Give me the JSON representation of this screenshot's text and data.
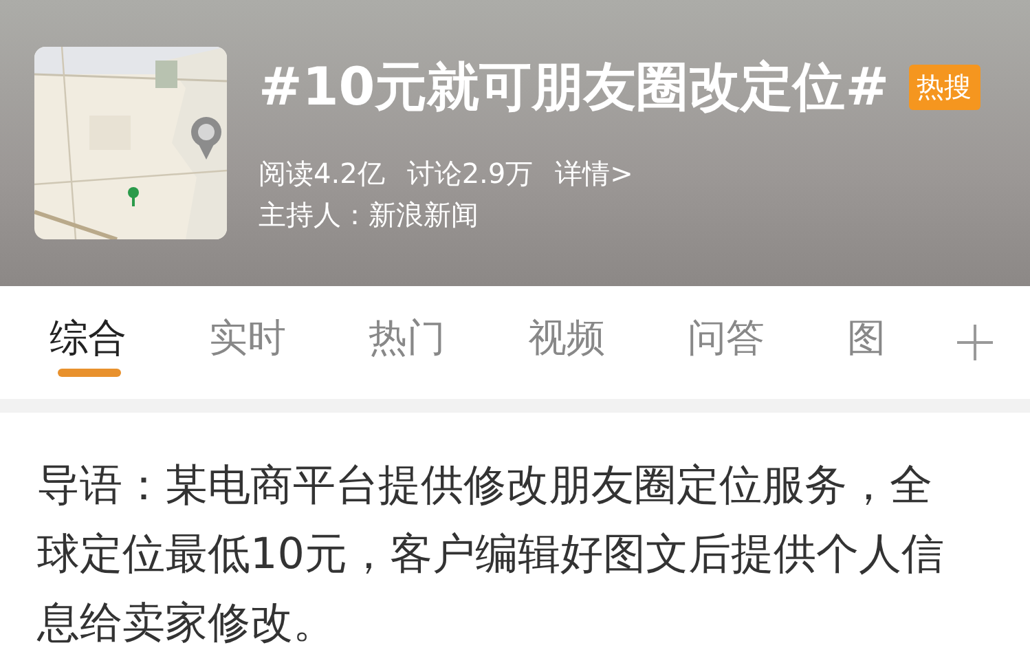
{
  "topic": {
    "kind": "picture",
    "title": "#10元就可朋友圈改定位#",
    "badge": "热搜",
    "stats": [
      {
        "label": "阅读4.2亿"
      },
      {
        "label": "讨论2.9万"
      },
      {
        "label": "详情>"
      }
    ],
    "host": "主持人：新浪新闻"
  },
  "tabs": [
    {
      "label": "综合",
      "selected": true
    },
    {
      "label": "实时",
      "selected": false
    },
    {
      "label": "热门",
      "selected": false
    },
    {
      "label": "视频",
      "selected": false
    },
    {
      "label": "问答",
      "selected": false
    },
    {
      "label": "图",
      "selected": false
    }
  ],
  "intro": "导语：某电商平台提供修改朋友圈定位服务，全球定位最低10元，客户编辑好图文后提供个人信息给卖家修改。"
}
